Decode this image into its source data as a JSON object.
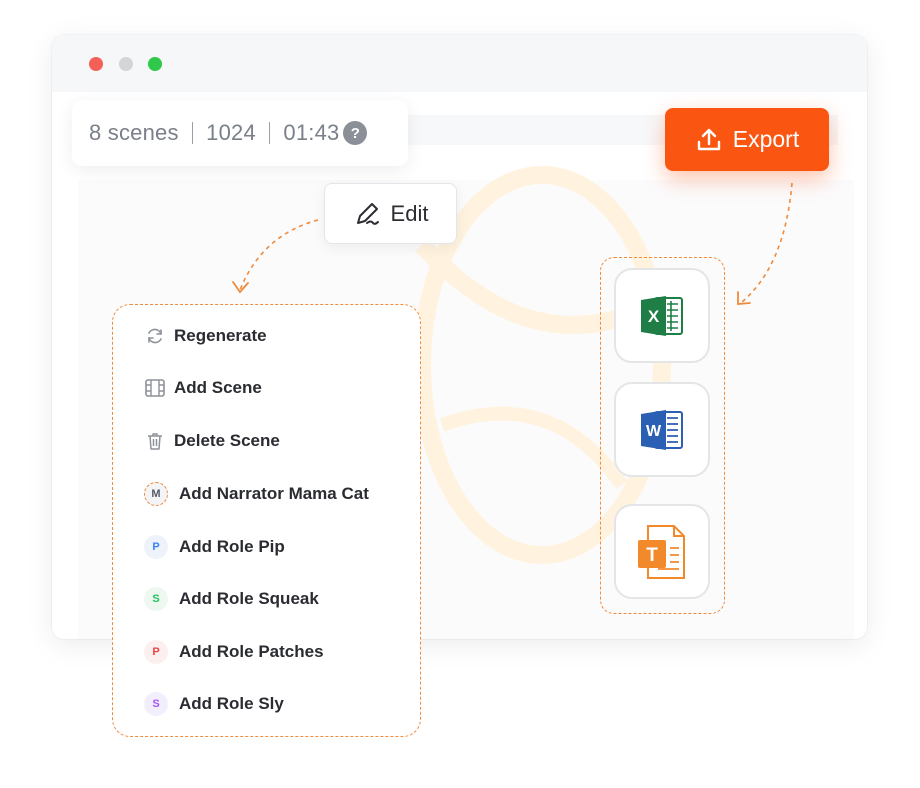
{
  "stats": {
    "scenes": "8 scenes",
    "count": "1024",
    "duration": "01:43",
    "help_glyph": "?"
  },
  "export_button": {
    "label": "Export",
    "icon": "upload-icon"
  },
  "edit_button": {
    "label": "Edit",
    "icon": "pen-icon"
  },
  "menu": {
    "items": [
      {
        "label": "Regenerate",
        "icon": "refresh-icon"
      },
      {
        "label": "Add Scene",
        "icon": "film-icon"
      },
      {
        "label": "Delete Scene",
        "icon": "trash-icon"
      },
      {
        "label": "Add Narrator Mama Cat",
        "avatar": "M",
        "avatar_color": "#555b66",
        "avatar_bg": "#f3f4f6"
      },
      {
        "label": "Add Role Pip",
        "avatar": "P",
        "avatar_color": "#3b82f6",
        "avatar_bg": "#eef2fb"
      },
      {
        "label": "Add Role Squeak",
        "avatar": "S",
        "avatar_color": "#22c55e",
        "avatar_bg": "#eef7f0"
      },
      {
        "label": "Add Role Patches",
        "avatar": "P",
        "avatar_color": "#ef4444",
        "avatar_bg": "#fbefef"
      },
      {
        "label": "Add Role Sly",
        "avatar": "S",
        "avatar_color": "#a855f7",
        "avatar_bg": "#f3eefb"
      }
    ]
  },
  "export_formats": [
    {
      "name": "excel-icon",
      "glyph": "X",
      "color": "#1e7e45"
    },
    {
      "name": "word-icon",
      "glyph": "W",
      "color": "#2b5fb4"
    },
    {
      "name": "text-icon",
      "glyph": "T",
      "color": "#f28a2c"
    }
  ],
  "colors": {
    "accent": "#fa5612",
    "dashed": "#f08a3c"
  }
}
